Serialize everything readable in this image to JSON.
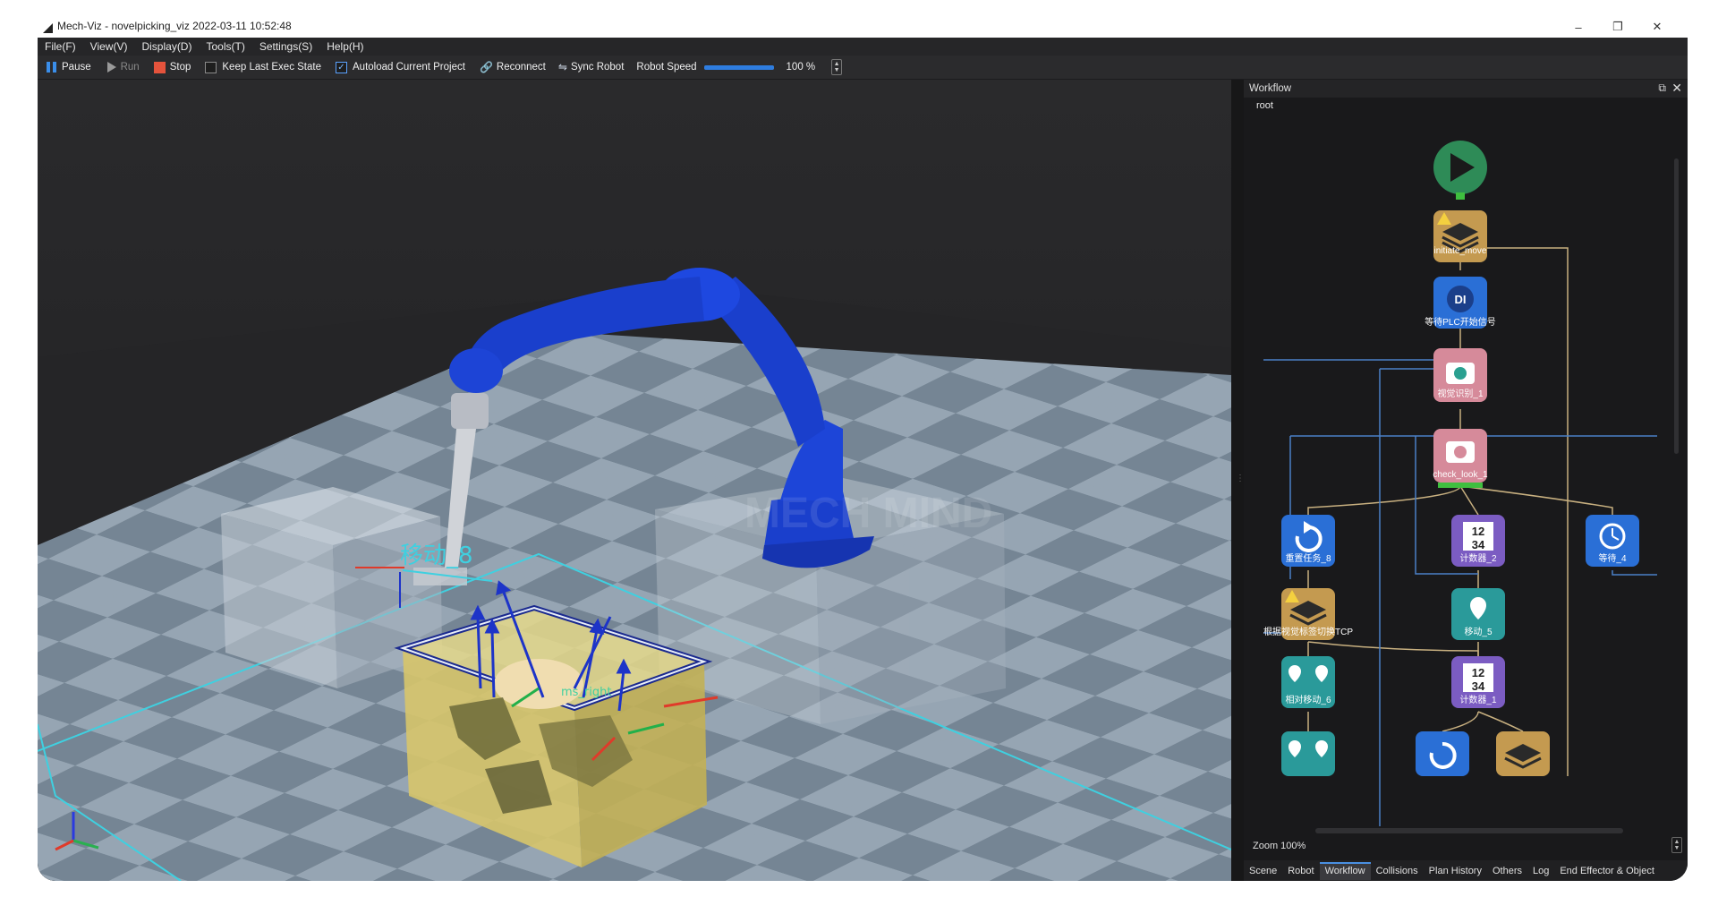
{
  "window": {
    "title": "Mech-Viz - novelpicking_viz 2022-03-11 10:52:48",
    "minimize": "–",
    "restore": "❐",
    "close": "✕"
  },
  "menu": [
    "File(F)",
    "View(V)",
    "Display(D)",
    "Tools(T)",
    "Settings(S)",
    "Help(H)"
  ],
  "toolbar": {
    "pause": "Pause",
    "run": "Run",
    "stop": "Stop",
    "keep_last_exec_state": {
      "label": "Keep Last Exec State",
      "checked": false
    },
    "autoload_current_project": {
      "label": "Autoload Current Project",
      "checked": true
    },
    "reconnect": "Reconnect",
    "sync_robot": "Sync Robot",
    "robot_speed_label": "Robot Speed",
    "robot_speed_value": "100 %",
    "robot_speed_fraction": 1.0
  },
  "scene": {
    "move_label": "移动_8",
    "tool_label": "ms_right"
  },
  "workflow": {
    "title": "Workflow",
    "root": "root",
    "zoom": "Zoom 100%",
    "nodes": [
      {
        "id": "start",
        "label": "",
        "icon": "play-icon"
      },
      {
        "id": "initiate_move",
        "label": "initiate_move",
        "icon": "layers-icon",
        "warning": true
      },
      {
        "id": "wait_plc",
        "label": "等待PLC开始信号",
        "icon": "di-icon"
      },
      {
        "id": "vision1",
        "label": "视觉识别_1",
        "icon": "camera-icon"
      },
      {
        "id": "check_look",
        "label": "check_look_1",
        "icon": "camera-check-icon"
      },
      {
        "id": "reset8",
        "label": "重置任务_8",
        "icon": "reset-icon"
      },
      {
        "id": "counter2",
        "label": "计数器_2",
        "icon": "counter-icon"
      },
      {
        "id": "wait4",
        "label": "等待_4",
        "icon": "timer-icon"
      },
      {
        "id": "switch_tcp",
        "label": "根据视觉标签切换TCP",
        "icon": "layers-icon",
        "warning": true
      },
      {
        "id": "move5",
        "label": "移动_5",
        "icon": "move-icon"
      },
      {
        "id": "rel_move6",
        "label": "相对移动_6",
        "icon": "relative-move-icon"
      },
      {
        "id": "counter1",
        "label": "计数器_1",
        "icon": "counter-icon"
      },
      {
        "id": "rel_move7",
        "label": "",
        "icon": "relative-move-icon"
      },
      {
        "id": "reset9",
        "label": "",
        "icon": "reset-icon"
      },
      {
        "id": "layers3",
        "label": "",
        "icon": "layers-icon"
      }
    ]
  },
  "tabs": [
    "Scene",
    "Robot",
    "Workflow",
    "Collisions",
    "Plan History",
    "Others",
    "Log",
    "End Effector & Object"
  ],
  "active_tab": "Workflow",
  "colors": {
    "robot": "#1a3fcc",
    "bin_fill": "#d8c96a",
    "floor_light": "#93a6b6",
    "floor_dark": "#6e7f8f",
    "node_play": "#2e8b57",
    "node_layers": "#c49a50",
    "node_blue": "#2a6fd6",
    "node_pink": "#d68a9a",
    "node_purple": "#7b5cc2",
    "node_teal": "#2a9a9a"
  }
}
